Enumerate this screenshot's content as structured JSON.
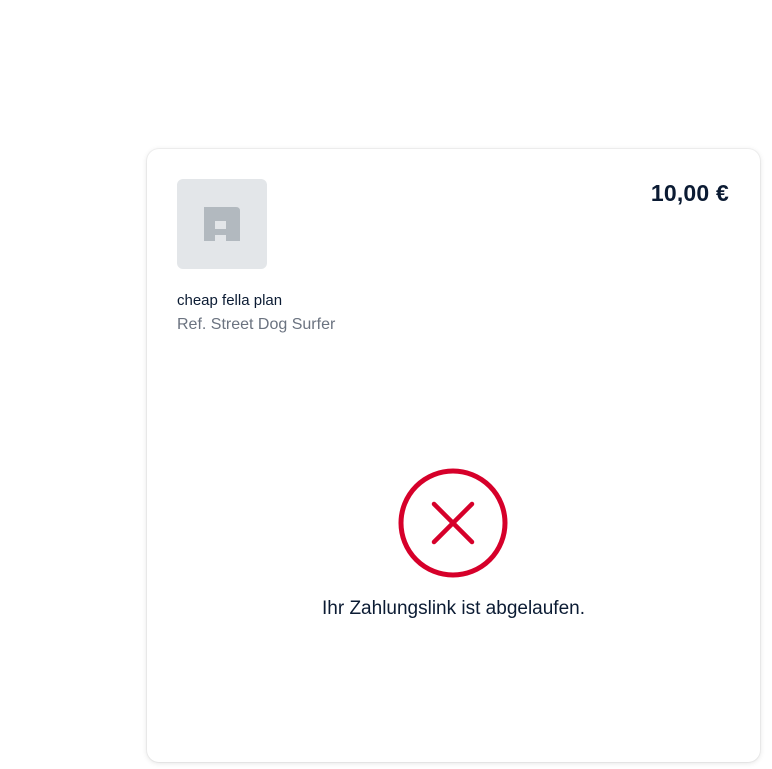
{
  "order": {
    "price": "10,00 €",
    "product_name": "cheap fella plan",
    "reference": "Ref. Street Dog Surfer"
  },
  "status": {
    "icon": "close-circle-icon",
    "color": "#d6002a",
    "message": "Ihr Zahlungslink ist abgelaufen."
  },
  "merchant": {
    "logo_icon": "merchant-logo-icon",
    "logo_color": "#b2b9bf",
    "logo_background": "#e3e6e9"
  }
}
